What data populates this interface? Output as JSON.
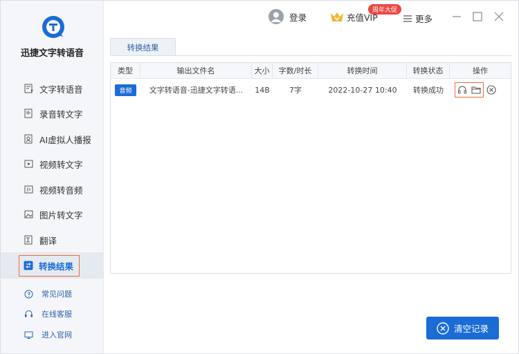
{
  "app": {
    "name": "迅捷文字转语音"
  },
  "sidebar": {
    "items": [
      {
        "label": "文字转语音",
        "icon": "text-to-speech-icon"
      },
      {
        "label": "录音转文字",
        "icon": "recording-to-text-icon"
      },
      {
        "label": "AI虚拟人播报",
        "icon": "ai-avatar-icon"
      },
      {
        "label": "视频转文字",
        "icon": "video-to-text-icon"
      },
      {
        "label": "视频转音频",
        "icon": "video-to-audio-icon"
      },
      {
        "label": "图片转文字",
        "icon": "image-to-text-icon"
      },
      {
        "label": "翻译",
        "icon": "translate-icon"
      },
      {
        "label": "转换结果",
        "icon": "results-icon",
        "active": true
      }
    ],
    "help": [
      {
        "label": "常见问题",
        "icon": "question-icon"
      },
      {
        "label": "在线客服",
        "icon": "headset-icon"
      },
      {
        "label": "进入官网",
        "icon": "website-icon"
      }
    ]
  },
  "topbar": {
    "login_label": "登录",
    "vip_label": "充值VIP",
    "vip_badge": "周年大促",
    "more_label": "更多"
  },
  "tabs": [
    {
      "label": "转换结果"
    }
  ],
  "table": {
    "headers": [
      "类型",
      "输出文件名",
      "大小",
      "字数/时长",
      "转换时间",
      "转换状态",
      "操作"
    ],
    "rows": [
      {
        "type": "音频",
        "filename": "文字转语音-迅捷文字转语...",
        "size": "14B",
        "count": "7字",
        "time": "2022-10-27 10:40",
        "status": "转换成功"
      }
    ]
  },
  "actions": {
    "clear_label": "清空记录"
  },
  "colors": {
    "accent": "#1a6cd6",
    "highlight": "#f0693a",
    "badge": "#ef4545",
    "sidebar_bg": "#f4f6f9"
  }
}
